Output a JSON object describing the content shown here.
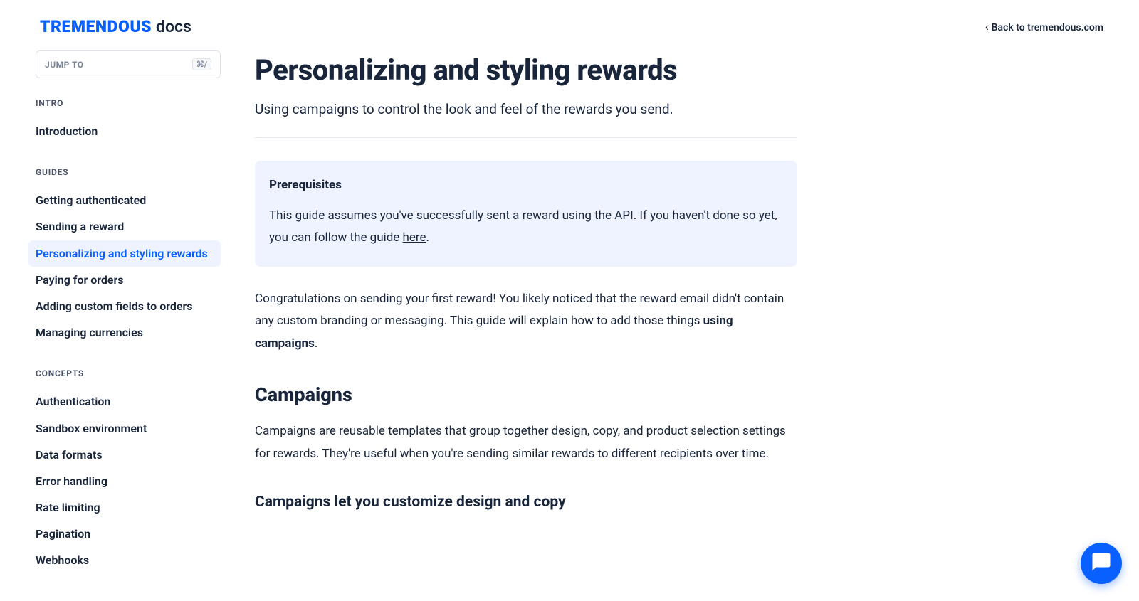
{
  "header": {
    "brand": "TREMENDOUS",
    "docs_label": "docs",
    "back_link": "Back to tremendous.com"
  },
  "sidebar": {
    "jump_to_label": "JUMP TO",
    "jump_to_key": "⌘/",
    "sections": [
      {
        "title": "INTRO",
        "items": [
          {
            "label": "Introduction",
            "active": false
          }
        ]
      },
      {
        "title": "GUIDES",
        "items": [
          {
            "label": "Getting authenticated",
            "active": false
          },
          {
            "label": "Sending a reward",
            "active": false
          },
          {
            "label": "Personalizing and styling rewards",
            "active": true
          },
          {
            "label": "Paying for orders",
            "active": false
          },
          {
            "label": "Adding custom fields to orders",
            "active": false
          },
          {
            "label": "Managing currencies",
            "active": false
          }
        ]
      },
      {
        "title": "CONCEPTS",
        "items": [
          {
            "label": "Authentication",
            "active": false
          },
          {
            "label": "Sandbox environment",
            "active": false
          },
          {
            "label": "Data formats",
            "active": false
          },
          {
            "label": "Error handling",
            "active": false
          },
          {
            "label": "Rate limiting",
            "active": false
          },
          {
            "label": "Pagination",
            "active": false
          },
          {
            "label": "Webhooks",
            "active": false
          }
        ]
      }
    ]
  },
  "main": {
    "title": "Personalizing and styling rewards",
    "subtitle": "Using campaigns to control the look and feel of the rewards you send.",
    "callout": {
      "title": "Prerequisites",
      "text_before": "This guide assumes you've successfully sent a reward using the API. If you haven't done so yet, you can follow the guide ",
      "link_text": "here",
      "text_after": "."
    },
    "intro_text_1": "Congratulations on sending your first reward! You likely noticed that the reward email didn't contain any custom branding or messaging. This guide will explain how to add those things ",
    "intro_strong": "using campaigns",
    "intro_text_2": ".",
    "section_heading": "Campaigns",
    "section_text": "Campaigns are reusable templates that group together design, copy, and product selection settings for rewards. They're useful when you're sending similar rewards to different recipients over time.",
    "sub_heading": "Campaigns let you customize design and copy"
  }
}
